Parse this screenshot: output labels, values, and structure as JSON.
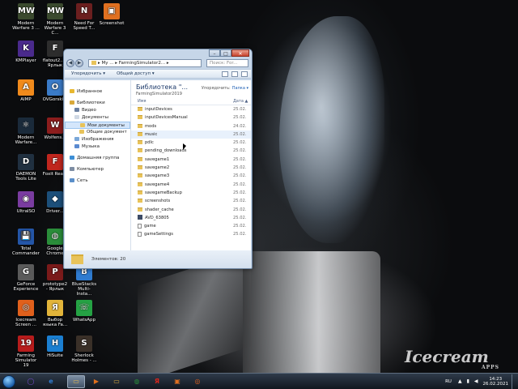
{
  "desktop": {
    "icons": [
      {
        "label": "Modern Warfare 3 ...",
        "icon": "mw3-game-icon",
        "color": "#3b4a2e",
        "glyph": "MW"
      },
      {
        "label": "Modern Warfare 3 C...",
        "icon": "mw3-game-icon",
        "color": "#3b4a2e",
        "glyph": "MW"
      },
      {
        "label": "Need For Speed T...",
        "icon": "nfs-game-icon",
        "color": "#6b1f1f",
        "glyph": "N"
      },
      {
        "label": "Screenshot",
        "icon": "screenshot-icon",
        "color": "#e07020",
        "glyph": "▣"
      },
      {
        "label": "KMPlayer",
        "icon": "kmplayer-icon",
        "color": "#4a2a8c",
        "glyph": "K"
      },
      {
        "label": "flatout2... - Ярлык",
        "icon": "flatout-game-icon",
        "color": "#2d2d2d",
        "glyph": "F"
      },
      {
        "label": "AIMP",
        "icon": "aimp-icon",
        "color": "#f08a1c",
        "glyph": "A"
      },
      {
        "label": "OVGorski...",
        "icon": "ovgorski-icon",
        "color": "#3a7bc8",
        "glyph": "O"
      },
      {
        "label": "Modern Warfare...",
        "icon": "atom-icon",
        "color": "#1a2a3a",
        "glyph": "⚛"
      },
      {
        "label": "Wolfens...",
        "icon": "wolfenstein-game-icon",
        "color": "#8c1d1d",
        "glyph": "W"
      },
      {
        "label": "DAEMON Tools Lite",
        "icon": "daemon-tools-icon",
        "color": "#203040",
        "glyph": "D"
      },
      {
        "label": "Foxit Rea...",
        "icon": "foxit-reader-icon",
        "color": "#c0261e",
        "glyph": "F"
      },
      {
        "label": "UltraISO",
        "icon": "ultraiso-icon",
        "color": "#7a3ca0",
        "glyph": "◉"
      },
      {
        "label": "Driver...",
        "icon": "driver-icon",
        "color": "#1c4f7a",
        "glyph": "◆"
      },
      {
        "label": "Total Commander",
        "icon": "total-commander-icon",
        "color": "#2456a8",
        "glyph": "💾"
      },
      {
        "label": "Google Chrome",
        "icon": "chrome-icon",
        "color": "#2a8d3a",
        "glyph": "◍"
      },
      {
        "label": "GeForce Experience",
        "icon": "geforce-icon",
        "color": "#5a5a5a",
        "glyph": "G"
      },
      {
        "label": "prototype2 - Ярлык",
        "icon": "prototype-game-icon",
        "color": "#7a1a1a",
        "glyph": "P"
      },
      {
        "label": "BlueStacks Multi-Insta...",
        "icon": "bluestacks-icon",
        "color": "#2f7bd0",
        "glyph": "B"
      },
      {
        "label": "Icecream Screen ...",
        "icon": "icecream-recorder-icon",
        "color": "#e0601c",
        "glyph": "◎"
      },
      {
        "label": "Выбор языка Fa...",
        "icon": "language-select-icon",
        "color": "#e2b43a",
        "glyph": "Я"
      },
      {
        "label": "WhatsApp",
        "icon": "whatsapp-icon",
        "color": "#25a244",
        "glyph": "☏"
      },
      {
        "label": "Farming Simulator 19",
        "icon": "farming-sim-icon",
        "color": "#b71c1c",
        "glyph": "19"
      },
      {
        "label": "HiSuite",
        "icon": "hisuite-icon",
        "color": "#1b7fd1",
        "glyph": "H"
      },
      {
        "label": "Sherlock Holmes - ...",
        "icon": "sherlock-game-icon",
        "color": "#3a3028",
        "glyph": "S"
      }
    ]
  },
  "window": {
    "address_parts": [
      "My ...",
      "FarmingSimulator2...",
      ""
    ],
    "search_placeholder": "Поиск: For...",
    "toolbar": {
      "organize": "Упорядочить ▾",
      "share": "Общий доступ ▾"
    },
    "nav": [
      {
        "label": "Избранное",
        "indent": 0,
        "icon": "star-icon",
        "color": "#e8b830",
        "selected": false
      },
      {
        "label": "",
        "indent": 0,
        "icon": "",
        "color": "",
        "selected": false
      },
      {
        "label": "Библиотеки",
        "indent": 0,
        "icon": "library-icon",
        "color": "#d9a93a",
        "selected": false
      },
      {
        "label": "Видео",
        "indent": 1,
        "icon": "video-icon",
        "color": "#6a7fa0",
        "selected": false
      },
      {
        "label": "Документы",
        "indent": 1,
        "icon": "documents-icon",
        "color": "#cfd8e4",
        "selected": false
      },
      {
        "label": "Мои документы",
        "indent": 2,
        "icon": "folder-icon",
        "color": "#e8c35a",
        "selected": true
      },
      {
        "label": "Общие документ",
        "indent": 2,
        "icon": "folder-icon",
        "color": "#e8c35a",
        "selected": false
      },
      {
        "label": "Изображения",
        "indent": 1,
        "icon": "pictures-icon",
        "color": "#7aa7d8",
        "selected": false
      },
      {
        "label": "Музыка",
        "indent": 1,
        "icon": "music-icon",
        "color": "#5a8ad0",
        "selected": false
      },
      {
        "label": "",
        "indent": 0,
        "icon": "",
        "color": "",
        "selected": false
      },
      {
        "label": "Домашняя группа",
        "indent": 0,
        "icon": "homegroup-icon",
        "color": "#3d8fd6",
        "selected": false
      },
      {
        "label": "",
        "indent": 0,
        "icon": "",
        "color": "",
        "selected": false
      },
      {
        "label": "Компьютер",
        "indent": 0,
        "icon": "computer-icon",
        "color": "#7d8da3",
        "selected": false
      },
      {
        "label": "",
        "indent": 0,
        "icon": "",
        "color": "",
        "selected": false
      },
      {
        "label": "Сеть",
        "indent": 0,
        "icon": "network-icon",
        "color": "#5b8fc9",
        "selected": false
      }
    ],
    "library": {
      "title": "Библиотека \"...",
      "subtitle": "FarmingSimulator2019",
      "arrange_label": "Упорядочить:",
      "arrange_value": "Папка ▾"
    },
    "columns": {
      "name": "Имя",
      "date": "Дата ▲"
    },
    "files": [
      {
        "name": "inputDevices",
        "date": "25.02.",
        "type": "folder"
      },
      {
        "name": "inputDevicesManual",
        "date": "25.02.",
        "type": "folder"
      },
      {
        "name": "mods",
        "date": "24.02.",
        "type": "folder"
      },
      {
        "name": "music",
        "date": "25.02.",
        "type": "folder",
        "hover": true
      },
      {
        "name": "pdlc",
        "date": "25.02.",
        "type": "folder"
      },
      {
        "name": "pending_downloads",
        "date": "25.02.",
        "type": "folder"
      },
      {
        "name": "savegame1",
        "date": "25.02.",
        "type": "folder"
      },
      {
        "name": "savegame2",
        "date": "25.02.",
        "type": "folder"
      },
      {
        "name": "savegame3",
        "date": "25.02.",
        "type": "folder"
      },
      {
        "name": "savegame4",
        "date": "25.02.",
        "type": "folder"
      },
      {
        "name": "savegameBackup",
        "date": "25.02.",
        "type": "folder"
      },
      {
        "name": "screenshots",
        "date": "25.02.",
        "type": "folder"
      },
      {
        "name": "shader_cache",
        "date": "25.02.",
        "type": "folder"
      },
      {
        "name": "AVD_63805",
        "date": "25.02.",
        "type": "app"
      },
      {
        "name": "game",
        "date": "25.02.",
        "type": "file"
      },
      {
        "name": "gameSettings",
        "date": "25.02.",
        "type": "file"
      }
    ],
    "status": "Элементов: 20"
  },
  "taskbar": {
    "items": [
      {
        "icon": "explorer-icon",
        "color": "#e3b64a",
        "glyph": "▭",
        "active": true
      },
      {
        "icon": "media-player-icon",
        "color": "#e0701c",
        "glyph": "▶",
        "active": false
      },
      {
        "icon": "file-manager-icon",
        "color": "#d9a93a",
        "glyph": "▭",
        "active": false
      },
      {
        "icon": "chrome-taskbar-icon",
        "color": "#2a8d3a",
        "glyph": "◍",
        "active": false
      },
      {
        "icon": "yandex-browser-icon",
        "color": "#d9261c",
        "glyph": "Я",
        "active": false
      },
      {
        "icon": "screenshot-taskbar-icon",
        "color": "#e07020",
        "glyph": "▣",
        "active": false
      },
      {
        "icon": "icecream-taskbar-icon",
        "color": "#e0601c",
        "glyph": "◎",
        "active": false
      }
    ],
    "left_items": [
      {
        "icon": "alice-icon",
        "color": "#7a4fd6",
        "glyph": "◯"
      },
      {
        "icon": "ie-icon",
        "color": "#2f7bd0",
        "glyph": "e"
      }
    ],
    "lang": "RU",
    "time": "14:23",
    "date": "26.02.2021"
  },
  "watermark": {
    "main": "Icecream",
    "sub": "APPS"
  }
}
